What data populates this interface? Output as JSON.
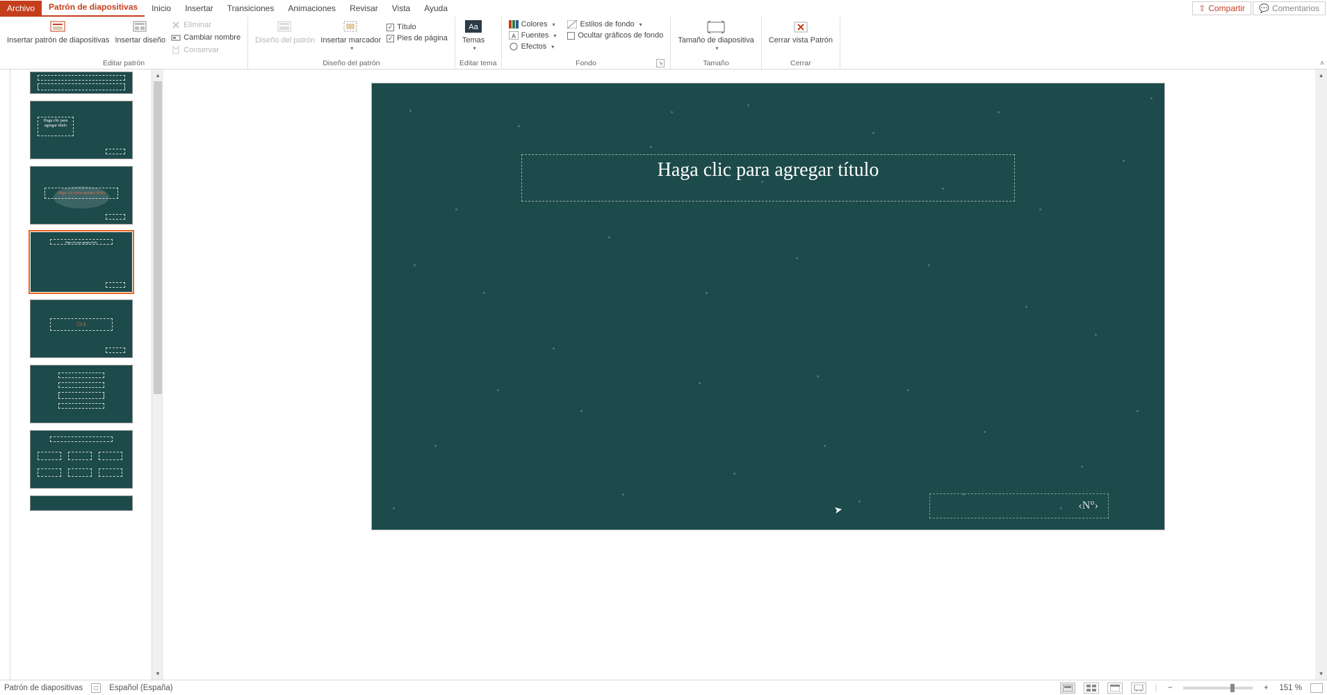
{
  "tabs": {
    "file": "Archivo",
    "items": [
      "Patrón de diapositivas",
      "Inicio",
      "Insertar",
      "Transiciones",
      "Animaciones",
      "Revisar",
      "Vista",
      "Ayuda"
    ],
    "active_index": 0,
    "share": "Compartir",
    "comments": "Comentarios"
  },
  "ribbon": {
    "edit_master": {
      "insert_master": "Insertar patrón de diapositivas",
      "insert_layout": "Insertar diseño",
      "delete": "Eliminar",
      "rename": "Cambiar nombre",
      "preserve": "Conservar",
      "label": "Editar patrón"
    },
    "design": {
      "master_layout": "Diseño del patrón",
      "insert_placeholder": "Insertar marcador",
      "title_chk": "Título",
      "footers_chk": "Pies de página",
      "label": "Diseño del patrón"
    },
    "theme": {
      "themes": "Temas",
      "label": "Editar tema"
    },
    "background": {
      "colors": "Colores",
      "fonts": "Fuentes",
      "effects": "Efectos",
      "bg_styles": "Estilos de fondo",
      "hide_bg": "Ocultar gráficos de fondo",
      "label": "Fondo"
    },
    "size": {
      "slide_size": "Tamaño de diapositiva",
      "label": "Tamaño"
    },
    "close": {
      "close_master": "Cerrar vista Patrón",
      "label": "Cerrar"
    }
  },
  "slide": {
    "title_placeholder": "Haga clic para agregar título",
    "slide_number_placeholder": "‹N°›"
  },
  "thumbs": {
    "t2_text": "Haga clic para agregar título",
    "t3_text": "Haga clic para agregar título",
    "t5_text": "53 k"
  },
  "status": {
    "mode": "Patrón de diapositivas",
    "lang": "Español (España)",
    "zoom": "151 %"
  }
}
